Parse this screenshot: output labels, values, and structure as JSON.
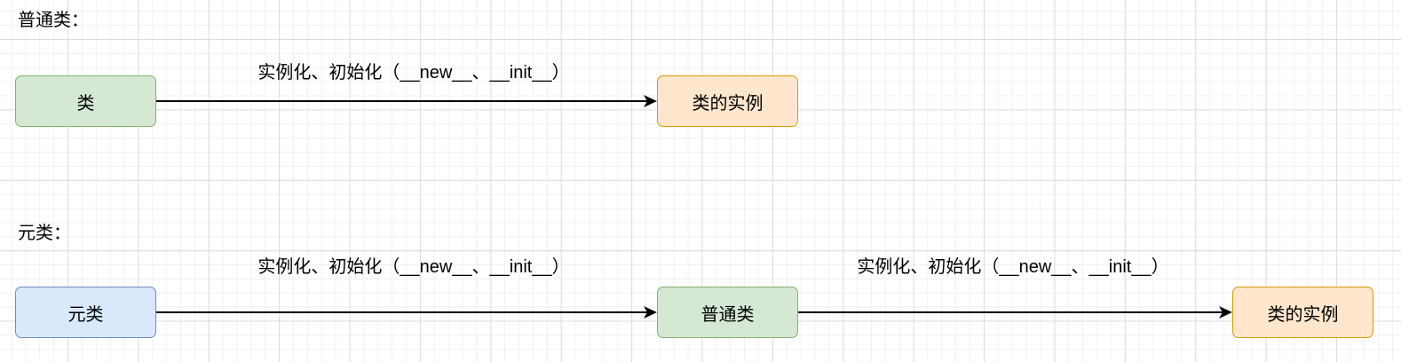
{
  "sections": {
    "ordinary": {
      "title": "普通类："
    },
    "meta": {
      "title": "元类："
    }
  },
  "nodes": {
    "class": {
      "label": "类",
      "style": "green"
    },
    "class_instance": {
      "label": "类的实例",
      "style": "orange"
    },
    "metaclass": {
      "label": "元类",
      "style": "blue"
    },
    "ordinary_class": {
      "label": "普通类",
      "style": "green"
    },
    "ordinary_instance": {
      "label": "类的实例",
      "style": "orange"
    }
  },
  "edges": {
    "class_to_instance": {
      "label": "实例化、初始化（__new__、__init__）"
    },
    "metaclass_to_class": {
      "label": "实例化、初始化（__new__、__init__）"
    },
    "class_to_ordinary_instance": {
      "label": "实例化、初始化（__new__、__init__）"
    }
  },
  "colors": {
    "green": {
      "fill": "#d5e8d4",
      "stroke": "#82b366"
    },
    "orange": {
      "fill": "#ffe6cc",
      "stroke": "#d79b00"
    },
    "blue": {
      "fill": "#dae8fc",
      "stroke": "#6c8ebf"
    },
    "edge": "#000000"
  }
}
